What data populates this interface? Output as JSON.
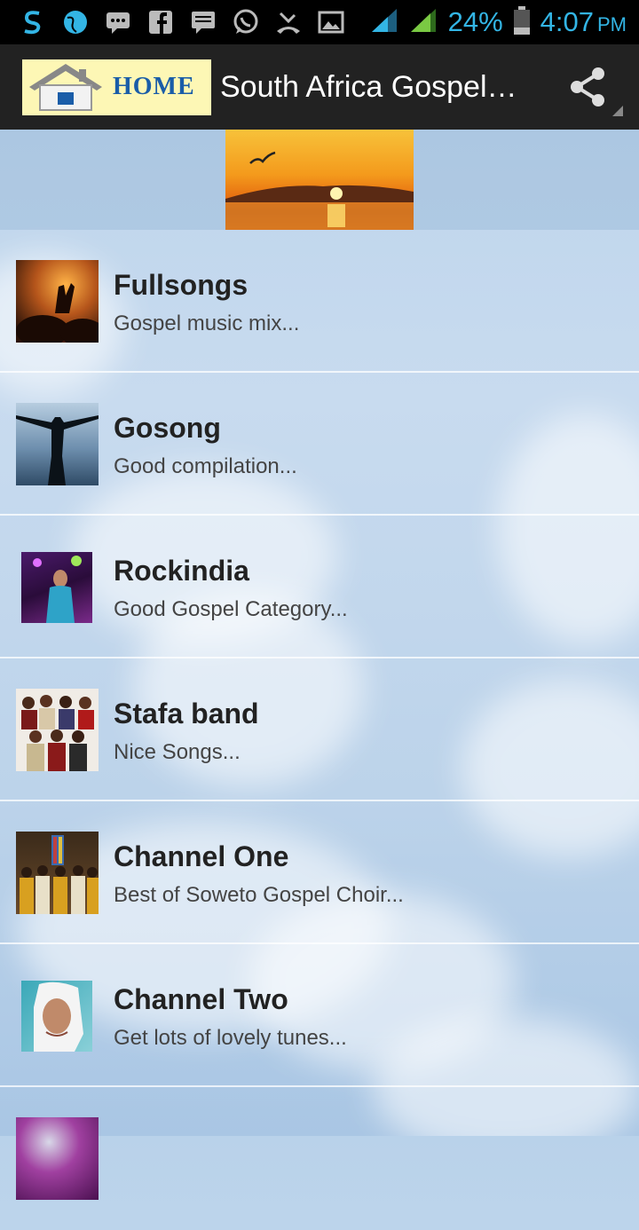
{
  "status_bar": {
    "battery": "24%",
    "time": "4:07",
    "ampm": "PM",
    "icons": [
      "s-app-icon",
      "globe-icon",
      "message-icon",
      "facebook-icon",
      "sms-icon",
      "whatsapp-icon",
      "missed-call-icon",
      "image-icon",
      "wifi-signal-icon",
      "cell-signal-icon",
      "battery-icon"
    ]
  },
  "action_bar": {
    "logo_text": "HOME",
    "title": "South Africa Gospel…",
    "share_icon": "share-icon"
  },
  "list": {
    "items": [
      {
        "title": "Fullsongs",
        "subtitle": "Gospel music mix..."
      },
      {
        "title": "Gosong",
        "subtitle": "Good compilation..."
      },
      {
        "title": "Rockindia",
        "subtitle": "Good Gospel Category..."
      },
      {
        "title": "Stafa band",
        "subtitle": "Nice Songs..."
      },
      {
        "title": "Channel One",
        "subtitle": "Best of Soweto Gospel Choir..."
      },
      {
        "title": "Channel Two",
        "subtitle": "Get lots of lovely tunes..."
      }
    ]
  }
}
